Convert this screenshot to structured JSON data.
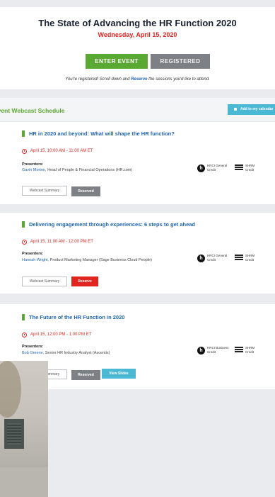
{
  "header": {
    "title": "The State of Advancing the HR Function 2020",
    "date": "Wednesday, April 15, 2020",
    "enter_label": "ENTER EVENT",
    "registered_label": "REGISTERED",
    "message_prefix": "You're registered! Scroll down and ",
    "message_link": "Reserve",
    "message_suffix": " the sessions you'd like to attend."
  },
  "schedule": {
    "title": "Event Webcast Schedule",
    "calendar_label": "Add to my calendar"
  },
  "events": [
    {
      "title": "HR in 2020 and beyond: What will shape the HR function?",
      "time": "April 15, 10:00 AM - 11:00 AM ET",
      "presenters_label": "Presenters:",
      "presenter_name": "Gavin Morton",
      "presenter_role": ", Head of People & Financial Operations (HR.com)",
      "credit1": "HRCI General Credit",
      "credit2": "SHRM Credit",
      "summary_label": "Webcast Summary",
      "action_label": "Reserved",
      "action_state": "reserved"
    },
    {
      "title": "Delivering engagement through experiences: 6 steps to get ahead",
      "time": "April 15, 11:00 AM - 12:00 PM ET",
      "presenters_label": "Presenters:",
      "presenter_name": "Hannah Wright",
      "presenter_role": ", Product Marketing Manager (Sage Business Cloud People)",
      "credit1": "HRCI General Credit",
      "credit2": "SHRM Credit",
      "summary_label": "Webcast Summary",
      "action_label": "Reserve",
      "action_state": "reserve"
    },
    {
      "title": "The Future of the HR Function in 2020",
      "time": "April 15, 12:00 PM - 1:00 PM ET",
      "presenters_label": "Presenters:",
      "presenter_name": "Bob Greene",
      "presenter_role": ", Senior HR Industry Analyst (Ascentis)",
      "credit1": "HRCI Business Credit",
      "credit2": "SHRM Credit",
      "summary_label": "Webcast Summary",
      "action_label": "Reserved",
      "action_state": "reserved",
      "slides_label": "View Slides"
    }
  ],
  "colors": {
    "accent_green": "#5aa932",
    "link_blue": "#1f64b6",
    "alert_red": "#e2261f",
    "button_grey": "#7d8186",
    "teal": "#4bb8d4"
  }
}
